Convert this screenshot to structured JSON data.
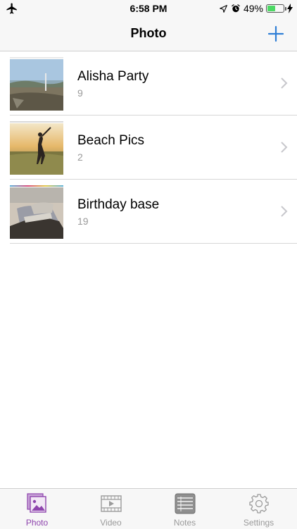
{
  "status_bar": {
    "time": "6:58 PM",
    "battery_percent": "49%",
    "battery_level": 0.49,
    "icons": [
      "airplane-icon",
      "location-icon",
      "alarm-icon",
      "battery-icon",
      "charging-icon"
    ]
  },
  "nav": {
    "title": "Photo",
    "add_icon": "plus-icon"
  },
  "albums": [
    {
      "title": "Alisha Party",
      "count": "9"
    },
    {
      "title": "Beach Pics",
      "count": "2"
    },
    {
      "title": "Birthday base",
      "count": "19"
    }
  ],
  "tabs": [
    {
      "label": "Photo",
      "icon": "photo-icon",
      "active": true
    },
    {
      "label": "Video",
      "icon": "video-icon",
      "active": false
    },
    {
      "label": "Notes",
      "icon": "notes-icon",
      "active": false
    },
    {
      "label": "Settings",
      "icon": "gear-icon",
      "active": false
    }
  ],
  "colors": {
    "accent": "#2f7fd6",
    "active_tab": "#8e44ad",
    "inactive": "#9a9a9a",
    "battery": "#4cd964"
  }
}
